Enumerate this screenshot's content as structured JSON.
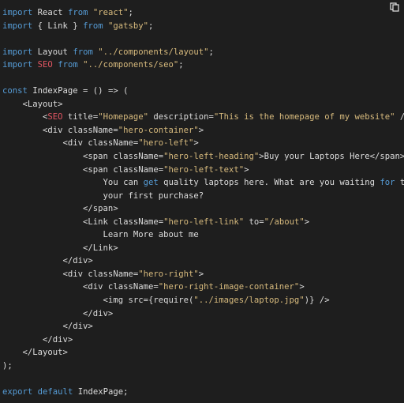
{
  "icons": {
    "copy": "copy-icon"
  },
  "colors": {
    "background": "#1e1e1e",
    "keyword": "#569cd6",
    "string": "#d7ba7d",
    "highlight": "#e05561",
    "text": "#dcdcdc"
  },
  "code": {
    "lines": [
      [
        [
          "k",
          "import"
        ],
        [
          "p",
          " React "
        ],
        [
          "k",
          "from"
        ],
        [
          "p",
          " "
        ],
        [
          "s",
          "\"react\""
        ],
        [
          "p",
          ";"
        ]
      ],
      [
        [
          "k",
          "import"
        ],
        [
          "p",
          " { Link } "
        ],
        [
          "k",
          "from"
        ],
        [
          "p",
          " "
        ],
        [
          "s",
          "\"gatsby\""
        ],
        [
          "p",
          ";"
        ]
      ],
      [],
      [
        [
          "k",
          "import"
        ],
        [
          "p",
          " Layout "
        ],
        [
          "k",
          "from"
        ],
        [
          "p",
          " "
        ],
        [
          "s",
          "\"../components/layout\""
        ],
        [
          "p",
          ";"
        ]
      ],
      [
        [
          "k",
          "import"
        ],
        [
          "p",
          " "
        ],
        [
          "c",
          "SEO"
        ],
        [
          "p",
          " "
        ],
        [
          "k",
          "from"
        ],
        [
          "p",
          " "
        ],
        [
          "s",
          "\"../components/seo\""
        ],
        [
          "p",
          ";"
        ]
      ],
      [],
      [
        [
          "k",
          "const"
        ],
        [
          "p",
          " IndexPage = () => ("
        ]
      ],
      [
        [
          "p",
          "    <Layout>"
        ]
      ],
      [
        [
          "p",
          "        <"
        ],
        [
          "c",
          "SEO"
        ],
        [
          "p",
          " title="
        ],
        [
          "s",
          "\"Homepage\""
        ],
        [
          "p",
          " description="
        ],
        [
          "s",
          "\"This is the homepage of my website\""
        ],
        [
          "p",
          " />"
        ]
      ],
      [
        [
          "p",
          "        <div className="
        ],
        [
          "s",
          "\"hero-container\""
        ],
        [
          "p",
          ">"
        ]
      ],
      [
        [
          "p",
          "            <div className="
        ],
        [
          "s",
          "\"hero-left\""
        ],
        [
          "p",
          ">"
        ]
      ],
      [
        [
          "p",
          "                <span className="
        ],
        [
          "s",
          "\"hero-left-heading\""
        ],
        [
          "p",
          ">Buy your Laptops Here</span>"
        ]
      ],
      [
        [
          "p",
          "                <span className="
        ],
        [
          "s",
          "\"hero-left-text\""
        ],
        [
          "p",
          ">"
        ]
      ],
      [
        [
          "p",
          "                    You can "
        ],
        [
          "k",
          "get"
        ],
        [
          "p",
          " quality laptops here. What are you waiting "
        ],
        [
          "k",
          "for"
        ],
        [
          "p",
          " to make"
        ]
      ],
      [
        [
          "p",
          "                    your first purchase?"
        ]
      ],
      [
        [
          "p",
          "                </span>"
        ]
      ],
      [
        [
          "p",
          "                <Link className="
        ],
        [
          "s",
          "\"hero-left-link\""
        ],
        [
          "p",
          " to="
        ],
        [
          "s",
          "\"/about\""
        ],
        [
          "p",
          ">"
        ]
      ],
      [
        [
          "p",
          "                    Learn More about me"
        ]
      ],
      [
        [
          "p",
          "                </Link>"
        ]
      ],
      [
        [
          "p",
          "            </div>"
        ]
      ],
      [
        [
          "p",
          "            <div className="
        ],
        [
          "s",
          "\"hero-right\""
        ],
        [
          "p",
          ">"
        ]
      ],
      [
        [
          "p",
          "                <div className="
        ],
        [
          "s",
          "\"hero-right-image-container\""
        ],
        [
          "p",
          ">"
        ]
      ],
      [
        [
          "p",
          "                    <img src={require("
        ],
        [
          "s",
          "\"../images/laptop.jpg\""
        ],
        [
          "p",
          ")} />"
        ]
      ],
      [
        [
          "p",
          "                </div>"
        ]
      ],
      [
        [
          "p",
          "            </div>"
        ]
      ],
      [
        [
          "p",
          "        </div>"
        ]
      ],
      [
        [
          "p",
          "    </Layout>"
        ]
      ],
      [
        [
          "p",
          ");"
        ]
      ],
      [],
      [
        [
          "k",
          "export"
        ],
        [
          "p",
          " "
        ],
        [
          "k",
          "default"
        ],
        [
          "p",
          " IndexPage;"
        ]
      ]
    ]
  }
}
